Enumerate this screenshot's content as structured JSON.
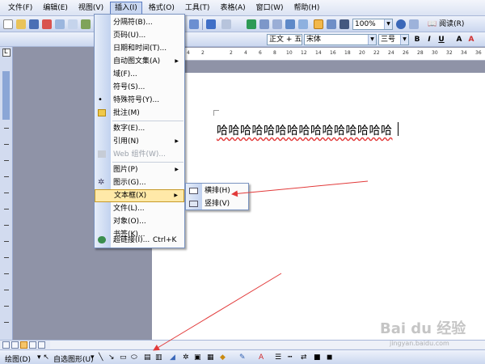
{
  "menubar": {
    "items": [
      "文件(F)",
      "编辑(E)",
      "视图(V)",
      "插入(I)",
      "格式(O)",
      "工具(T)",
      "表格(A)",
      "窗口(W)",
      "帮助(H)"
    ]
  },
  "toolbar": {
    "zoom": "100%",
    "read_label": "阅读(R)",
    "style": "正文 + 五号",
    "font": "宋体",
    "size": "三号",
    "bold": "B",
    "italic": "I",
    "underline": "U",
    "font_color": "A"
  },
  "ruler": {
    "numbers": [
      "4",
      "2",
      "",
      "2",
      "4",
      "6",
      "8",
      "10",
      "12",
      "14",
      "16",
      "18",
      "20",
      "22",
      "24",
      "26",
      "28",
      "30",
      "32",
      "34",
      "36"
    ]
  },
  "insert_menu": {
    "items": [
      {
        "label": "分隔符(B)..."
      },
      {
        "label": "页码(U)..."
      },
      {
        "label": "日期和时间(T)..."
      },
      {
        "label": "自动图文集(A)",
        "submenu": true
      },
      {
        "label": "域(F)..."
      },
      {
        "label": "符号(S)..."
      },
      {
        "label": "特殊符号(Y)..."
      },
      {
        "label": "批注(M)"
      },
      {
        "label": "数字(E)..."
      },
      {
        "label": "引用(N)",
        "submenu": true
      },
      {
        "label": "Web 组件(W)...",
        "disabled": true
      },
      {
        "label": "图片(P)",
        "submenu": true
      },
      {
        "label": "图示(G)..."
      },
      {
        "label": "文本框(X)",
        "submenu": true,
        "highlighted": true
      },
      {
        "label": "文件(L)..."
      },
      {
        "label": "对象(O)..."
      },
      {
        "label": "书签(K)..."
      },
      {
        "label": "超链接(I)...",
        "shortcut": "Ctrl+K"
      }
    ]
  },
  "textbox_submenu": {
    "items": [
      "横排(H)",
      "竖排(V)"
    ]
  },
  "document": {
    "text": "哈哈哈哈哈哈哈哈哈哈哈哈哈哈哈"
  },
  "drawing_toolbar": {
    "draw_label": "绘图(D)",
    "autoshapes_label": "自选图形(U)"
  },
  "watermark": {
    "brand": "Bai du 经验",
    "url": "jingyan.baidu.com"
  },
  "colors": {
    "menu_highlight": "#ffe9a8",
    "annotation_arrow": "#e23a3a",
    "gutter": "#c2d2ef"
  }
}
